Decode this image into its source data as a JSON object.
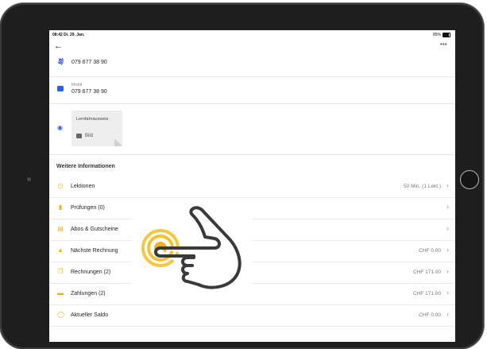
{
  "status_bar": {
    "time_date": "08:42  Di. 29. Jan.",
    "battery": "85%"
  },
  "header": {
    "back_icon": "arrow-left-icon",
    "more_icon": "ellipsis-icon"
  },
  "contacts": [
    {
      "icon": "phone-icon",
      "subtitle": "",
      "value": "079 677 38 90"
    },
    {
      "icon": "message-icon",
      "subtitle": "Mobil",
      "value": "079 677 38 90"
    }
  ],
  "document": {
    "icon": "eye-icon",
    "title": "Lernfahrausweis",
    "image_label": "Bild"
  },
  "section_title": "Weitere Informationen",
  "rows": [
    {
      "icon": "clock-icon",
      "label": "Lektionen",
      "value": "50 Min. (1 Lekt.)"
    },
    {
      "icon": "clipboard-icon",
      "label": "Prüfungen (0)",
      "value": ""
    },
    {
      "icon": "ticket-icon",
      "label": "Abos & Gutscheine",
      "value": ""
    },
    {
      "icon": "basket-icon",
      "label": "Nächste Rechnung",
      "value": "CHF 0.00"
    },
    {
      "icon": "copy-icon",
      "label": "Rechnungen (2)",
      "value": "CHF 171.00"
    },
    {
      "icon": "card-icon",
      "label": "Zahlungen (2)",
      "value": "CHF 171.00"
    },
    {
      "icon": "coin-icon",
      "label": "Aktueller Saldo",
      "value": "CHF 0.00"
    }
  ],
  "colors": {
    "accent_yellow": "#f2b01e",
    "accent_blue": "#2f5fe8",
    "bezel": "#1e1e1e"
  },
  "overlay": {
    "icon": "tap-hand-icon"
  }
}
